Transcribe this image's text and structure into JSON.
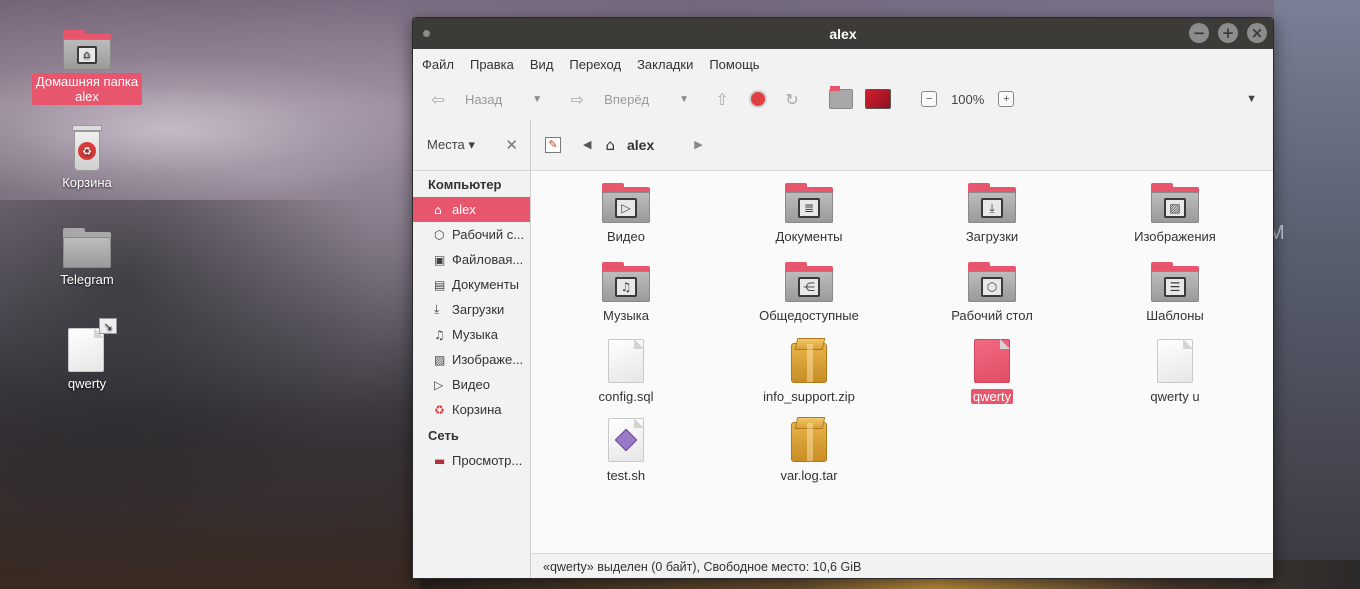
{
  "desktop": {
    "icons": [
      {
        "label": "Домашняя папка alex",
        "icon": "home-folder-icon"
      },
      {
        "label": "Корзина",
        "icon": "trash-icon"
      },
      {
        "label": "Telegram",
        "icon": "folder-icon"
      },
      {
        "label": "qwerty",
        "icon": "file-link-icon"
      }
    ]
  },
  "window": {
    "title": "alex",
    "buttons": {
      "minimize": "−",
      "maximize": "+",
      "close": "×"
    }
  },
  "menubar": {
    "items": [
      "Файл",
      "Правка",
      "Вид",
      "Переход",
      "Закладки",
      "Помощь"
    ]
  },
  "toolbar": {
    "back_label": "Назад",
    "forward_label": "Вперёд",
    "zoom_level": "100%"
  },
  "sidebar": {
    "header": "Места",
    "section_computer": "Компьютер",
    "computer_items": [
      {
        "label": "alex",
        "icon": "home-icon"
      },
      {
        "label": "Рабочий с...",
        "icon": "desktop-icon"
      },
      {
        "label": "Файловая...",
        "icon": "drive-icon"
      },
      {
        "label": "Документы",
        "icon": "documents-icon"
      },
      {
        "label": "Загрузки",
        "icon": "download-icon"
      },
      {
        "label": "Музыка",
        "icon": "music-icon"
      },
      {
        "label": "Изображе...",
        "icon": "image-icon"
      },
      {
        "label": "Видео",
        "icon": "video-icon"
      },
      {
        "label": "Корзина",
        "icon": "trash-icon"
      }
    ],
    "section_network": "Сеть",
    "network_items": [
      {
        "label": "Просмотр...",
        "icon": "network-icon"
      }
    ]
  },
  "pathbar": {
    "current": "alex"
  },
  "files": [
    {
      "name": "Видео",
      "kind": "folder",
      "glyph": "▷"
    },
    {
      "name": "Документы",
      "kind": "folder",
      "glyph": "≣"
    },
    {
      "name": "Загрузки",
      "kind": "folder",
      "glyph": "⤓"
    },
    {
      "name": "Изображения",
      "kind": "folder",
      "glyph": "▨"
    },
    {
      "name": "Музыка",
      "kind": "folder",
      "glyph": "♫"
    },
    {
      "name": "Общедоступные",
      "kind": "folder",
      "glyph": "⋲"
    },
    {
      "name": "Рабочий стол",
      "kind": "folder",
      "glyph": "⬡"
    },
    {
      "name": "Шаблоны",
      "kind": "folder",
      "glyph": "☰"
    },
    {
      "name": "config.sql",
      "kind": "file"
    },
    {
      "name": "info_support.zip",
      "kind": "archive"
    },
    {
      "name": "qwerty",
      "kind": "file-selected"
    },
    {
      "name": "qwerty u",
      "kind": "file"
    },
    {
      "name": "test.sh",
      "kind": "script"
    },
    {
      "name": "var.log.tar",
      "kind": "archive"
    }
  ],
  "statusbar": {
    "text": "«qwerty» выделен (0 байт), Свободное место: 10,6 GiB"
  },
  "colors": {
    "accent": "#e8566e",
    "titlebar": "#3c3b37"
  }
}
